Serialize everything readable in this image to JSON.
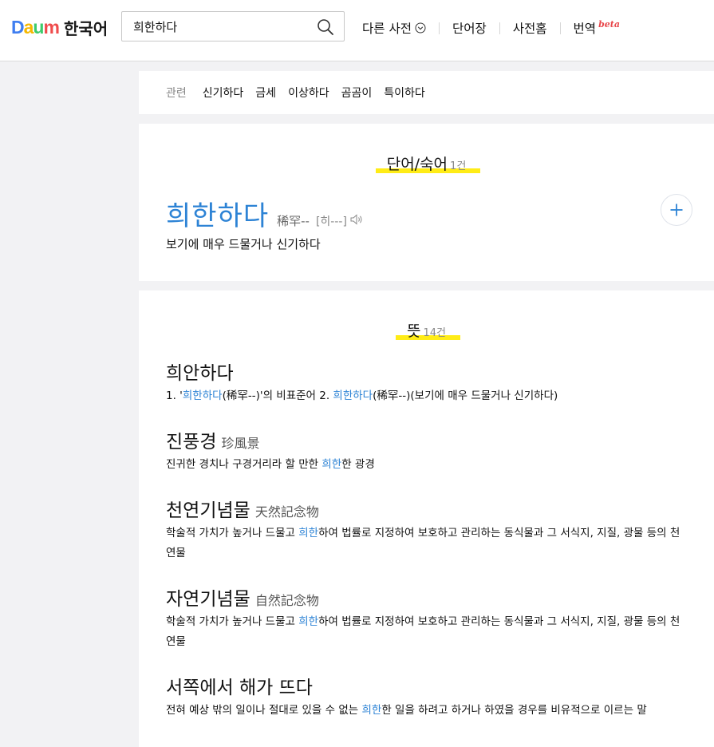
{
  "header": {
    "logo_letters": [
      "D",
      "a",
      "u",
      "m"
    ],
    "logo_colors": [
      "#3f7ef0",
      "#f5b800",
      "#3ccb6b",
      "#ef4c4c"
    ],
    "title": "한국어",
    "search": {
      "value": "희한하다",
      "placeholder": ""
    },
    "nav": [
      {
        "label": "다른 사전"
      },
      {
        "label": "단어장"
      },
      {
        "label": "사전홈"
      },
      {
        "label": "번역",
        "badge": "beta"
      }
    ]
  },
  "related": {
    "label": "관련",
    "items": [
      "신기하다",
      "금세",
      "이상하다",
      "곰곰이",
      "특이하다"
    ]
  },
  "word_section": {
    "title": "단어/숙어",
    "count": "1건",
    "entry": {
      "word": "희한하다",
      "hanja": "稀罕--",
      "pron": "[히---]",
      "definition": "보기에 매우 드물거나 신기하다"
    }
  },
  "meaning_section": {
    "title": "뜻",
    "count": "14건",
    "items": [
      {
        "title": "희안하다",
        "hanja": "",
        "desc": [
          [
            "1. '",
            ""
          ],
          [
            "희한하다",
            "blue"
          ],
          [
            "(稀罕--)'의 비표준어   2. ",
            ""
          ],
          [
            "희한하다",
            "blue"
          ],
          [
            "(稀罕--)(보기에 매우 드물거나 신기하다)",
            ""
          ]
        ]
      },
      {
        "title": "진풍경",
        "hanja": "珍風景",
        "desc": [
          [
            "진귀한 경치나 구경거리라 할 만한 ",
            ""
          ],
          [
            "희한",
            "blue"
          ],
          [
            "한 광경",
            ""
          ]
        ]
      },
      {
        "title": "천연기념물",
        "hanja": "天然記念物",
        "desc": [
          [
            "학술적 가치가 높거나 드물고 ",
            ""
          ],
          [
            "희한",
            "blue"
          ],
          [
            "하여 법률로 지정하여 보호하고 관리하는 동식물과 그 서식지, 지질, 광물 등의 천연물",
            ""
          ]
        ]
      },
      {
        "title": "자연기념물",
        "hanja": "自然記念物",
        "desc": [
          [
            "학술적 가치가 높거나 드물고 ",
            ""
          ],
          [
            "희한",
            "blue"
          ],
          [
            "하여 법률로 지정하여 보호하고 관리하는 동식물과 그 서식지, 지질, 광물 등의 천연물",
            ""
          ]
        ]
      },
      {
        "title": "서쪽에서 해가 뜨다",
        "hanja": "",
        "desc": [
          [
            "전혀 예상 밖의 일이나 절대로 있을 수 없는 ",
            ""
          ],
          [
            "희한",
            "blue"
          ],
          [
            "한 일을 하려고 하거나 하였을 경우를 비유적으로 이르는 말",
            ""
          ]
        ]
      }
    ]
  }
}
